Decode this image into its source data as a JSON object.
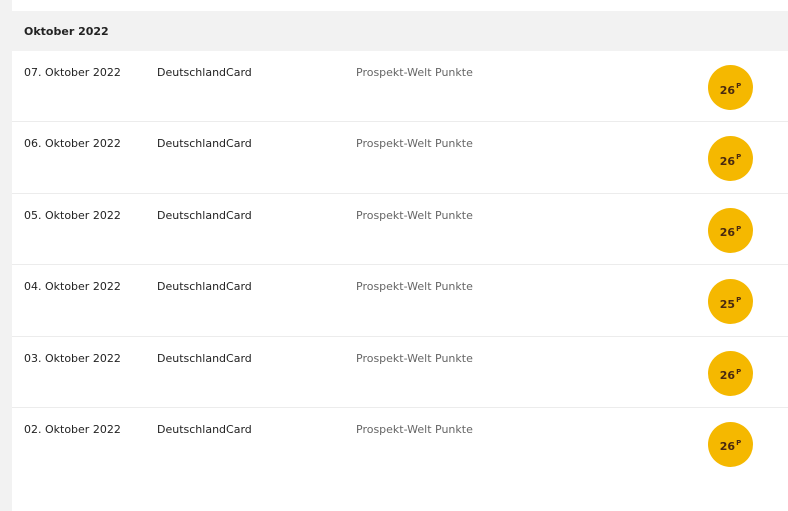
{
  "month": {
    "label": "Oktober 2022"
  },
  "transactions": [
    {
      "date": "07. Oktober 2022",
      "partner": "DeutschlandCard",
      "description": "Prospekt-Welt Punkte",
      "points": "26",
      "unit": "P"
    },
    {
      "date": "06. Oktober 2022",
      "partner": "DeutschlandCard",
      "description": "Prospekt-Welt Punkte",
      "points": "26",
      "unit": "P"
    },
    {
      "date": "05. Oktober 2022",
      "partner": "DeutschlandCard",
      "description": "Prospekt-Welt Punkte",
      "points": "26",
      "unit": "P"
    },
    {
      "date": "04. Oktober 2022",
      "partner": "DeutschlandCard",
      "description": "Prospekt-Welt Punkte",
      "points": "25",
      "unit": "P"
    },
    {
      "date": "03. Oktober 2022",
      "partner": "DeutschlandCard",
      "description": "Prospekt-Welt Punkte",
      "points": "26",
      "unit": "P"
    },
    {
      "date": "02. Oktober 2022",
      "partner": "DeutschlandCard",
      "description": "Prospekt-Welt Punkte",
      "points": "26",
      "unit": "P"
    }
  ],
  "colors": {
    "badge": "#f5b800",
    "badge_text": "#4a2a10",
    "header_bg": "#f2f2f2"
  }
}
